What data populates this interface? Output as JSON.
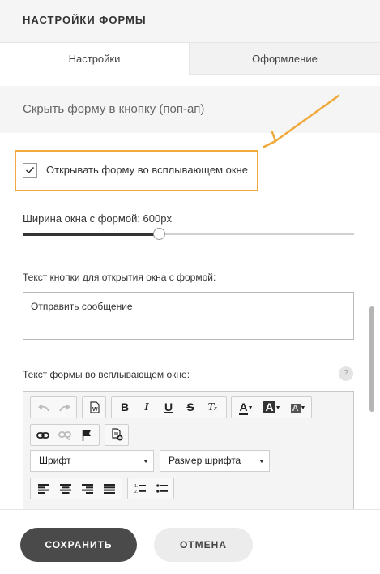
{
  "header": {
    "title": "НАСТРОЙКИ ФОРМЫ"
  },
  "tabs": [
    {
      "label": "Настройки",
      "active": true
    },
    {
      "label": "Оформление",
      "active": false
    }
  ],
  "section": {
    "title": "Скрыть форму в кнопку (поп-ап)"
  },
  "popup_checkbox": {
    "label": "Открывать форму во всплывающем окне",
    "checked": true
  },
  "width_slider": {
    "label": "Ширина окна с формой: 600px",
    "value_fraction": 0.41
  },
  "button_text": {
    "label": "Текст кнопки для открытия окна с формой:",
    "value": "Отправить сообщение"
  },
  "popup_text": {
    "label": "Текст формы во всплывающем окне:",
    "help": "?"
  },
  "editor": {
    "font_select": "Шрифт",
    "size_select": "Размер шрифта",
    "icons": [
      "undo-icon",
      "redo-icon",
      "paste-from-word-icon",
      "bold-icon",
      "italic-icon",
      "underline-icon",
      "strikethrough-icon",
      "remove-format-icon",
      "text-color-icon",
      "bg-color-icon",
      "text-bg-icon",
      "link-icon",
      "unlink-icon",
      "anchor-icon",
      "insert-template-icon",
      "align-left-icon",
      "align-center-icon",
      "align-right-icon",
      "justify-icon",
      "numbered-list-icon",
      "bulleted-list-icon"
    ]
  },
  "footer": {
    "save_label": "СОХРАНИТЬ",
    "cancel_label": "ОТМЕНА"
  },
  "colors": {
    "highlight": "#f0a93a",
    "dark_button": "#4a4a4a"
  }
}
